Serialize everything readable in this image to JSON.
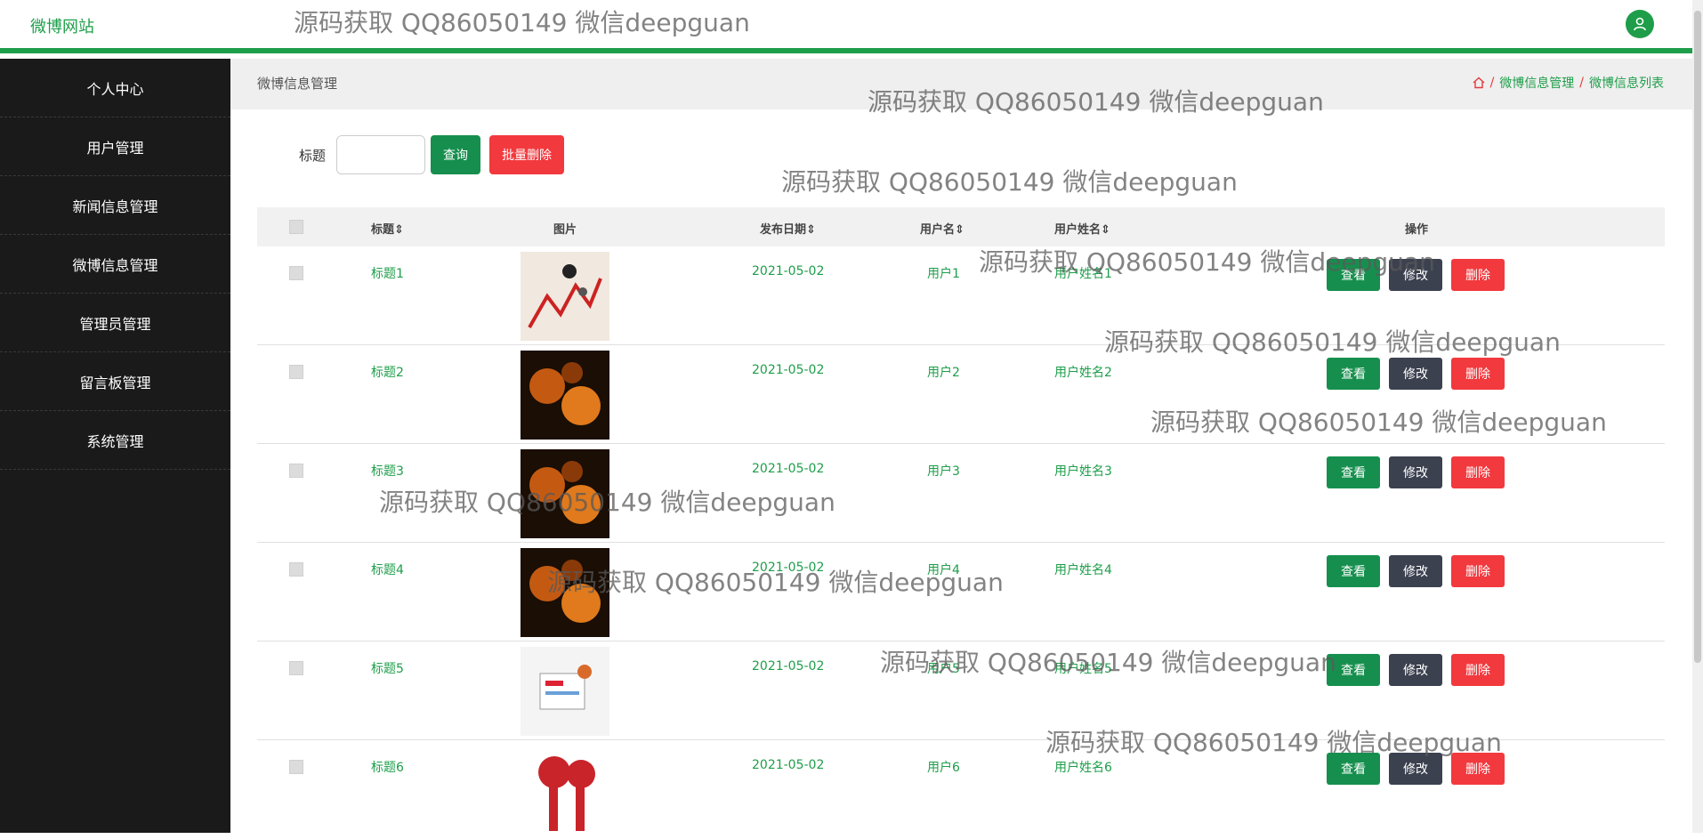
{
  "header": {
    "site_title": "微博网站"
  },
  "sidebar": {
    "items": [
      {
        "label": "个人中心"
      },
      {
        "label": "用户管理"
      },
      {
        "label": "新闻信息管理"
      },
      {
        "label": "微博信息管理"
      },
      {
        "label": "管理员管理"
      },
      {
        "label": "留言板管理"
      },
      {
        "label": "系统管理"
      }
    ]
  },
  "main": {
    "page_title": "微博信息管理",
    "breadcrumb": [
      "微博信息管理",
      "微博信息列表"
    ],
    "search": {
      "label": "标题",
      "value": "",
      "query_button": "查询",
      "batch_delete_button": "批量删除"
    },
    "table": {
      "headers": [
        "标题",
        "图片",
        "发布日期",
        "用户名",
        "用户姓名",
        "操作"
      ],
      "rows": [
        {
          "title": "标题1",
          "date": "2021-05-02",
          "username": "用户1",
          "realname": "用户姓名1"
        },
        {
          "title": "标题2",
          "date": "2021-05-02",
          "username": "用户2",
          "realname": "用户姓名2"
        },
        {
          "title": "标题3",
          "date": "2021-05-02",
          "username": "用户3",
          "realname": "用户姓名3"
        },
        {
          "title": "标题4",
          "date": "2021-05-02",
          "username": "用户4",
          "realname": "用户姓名4"
        },
        {
          "title": "标题5",
          "date": "2021-05-02",
          "username": "用户5",
          "realname": "用户姓名5"
        },
        {
          "title": "标题6",
          "date": "2021-05-02",
          "username": "用户6",
          "realname": "用户姓名6"
        }
      ],
      "actions": {
        "view": "查看",
        "edit": "修改",
        "delete": "删除"
      }
    }
  },
  "watermark": "源码获取 QQ86050149 微信deepguan",
  "colors": {
    "accent": "#1e9e4a",
    "danger": "#f2393e",
    "dark_button": "#3c4150",
    "sidebar": "#1a1a1a"
  },
  "icons": {
    "avatar": "user-icon",
    "breadcrumb_home": "home-icon"
  }
}
